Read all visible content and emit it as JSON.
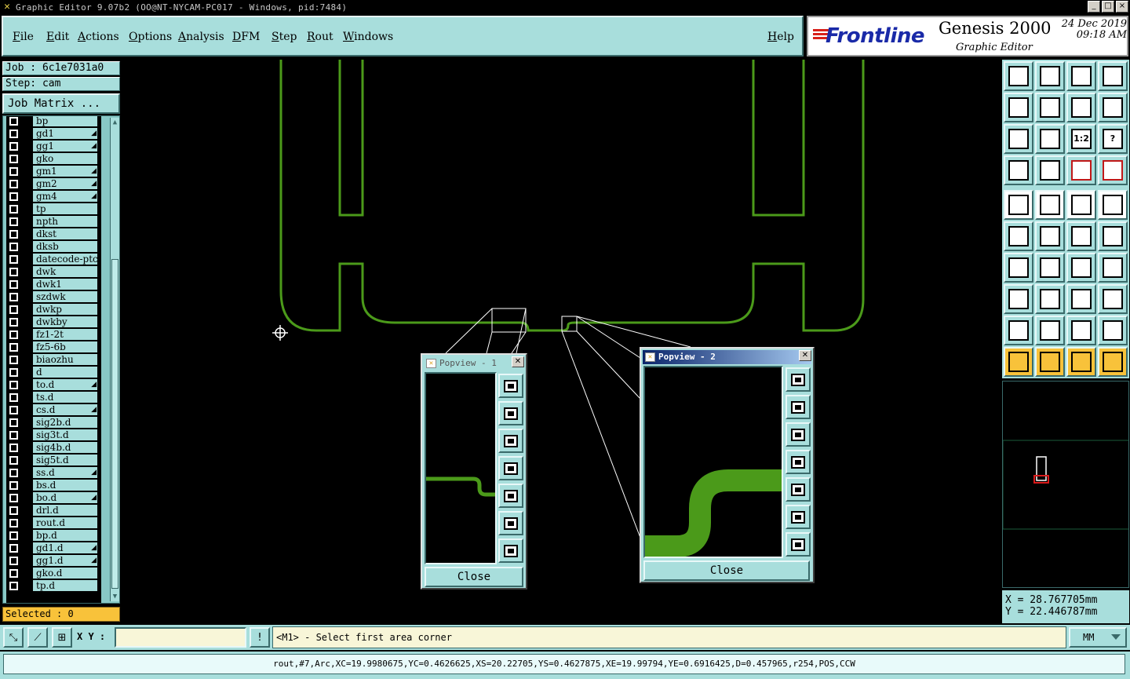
{
  "window": {
    "title": "Graphic Editor 9.07b2 (OO@NT-NYCAM-PC017 - Windows, pid:7484)",
    "controls": [
      "_",
      "□",
      "×"
    ]
  },
  "menu": [
    "File",
    "Edit",
    "Actions",
    "Options",
    "Analysis",
    "DFM",
    "Step",
    "Rout",
    "Windows"
  ],
  "help": "Help",
  "brand": {
    "logo": "Frontline",
    "product": "Genesis 2000",
    "subtitle": "Graphic Editor",
    "date": "24 Dec 2019",
    "time": "09:18 AM"
  },
  "job": {
    "job_label": "Job : 6c1e7031a0",
    "step_label": "Step: cam",
    "matrix_button": "Job Matrix ..."
  },
  "layers": [
    {
      "name": "bp",
      "mark": ""
    },
    {
      "name": "gd1",
      "mark": "◢"
    },
    {
      "name": "gg1",
      "mark": "◢"
    },
    {
      "name": "gko",
      "mark": ""
    },
    {
      "name": "gm1",
      "mark": "◢"
    },
    {
      "name": "gm2",
      "mark": "◢"
    },
    {
      "name": "gm4",
      "mark": "◢"
    },
    {
      "name": "tp",
      "mark": ""
    },
    {
      "name": "npth",
      "mark": ""
    },
    {
      "name": "dkst",
      "mark": ""
    },
    {
      "name": "dksb",
      "mark": ""
    },
    {
      "name": "datecode-ptc",
      "mark": ""
    },
    {
      "name": "dwk",
      "mark": ""
    },
    {
      "name": "dwk1",
      "mark": ""
    },
    {
      "name": "szdwk",
      "mark": ""
    },
    {
      "name": "dwkp",
      "mark": ""
    },
    {
      "name": "dwkby",
      "mark": ""
    },
    {
      "name": "fz1-2t",
      "mark": ""
    },
    {
      "name": "fz5-6b",
      "mark": ""
    },
    {
      "name": "biaozhu",
      "mark": ""
    },
    {
      "name": "d",
      "mark": ""
    },
    {
      "name": "to.d",
      "mark": "◢"
    },
    {
      "name": "ts.d",
      "mark": ""
    },
    {
      "name": "cs.d",
      "mark": "◢"
    },
    {
      "name": "sig2b.d",
      "mark": ""
    },
    {
      "name": "sig3t.d",
      "mark": ""
    },
    {
      "name": "sig4b.d",
      "mark": ""
    },
    {
      "name": "sig5t.d",
      "mark": ""
    },
    {
      "name": "ss.d",
      "mark": "◢"
    },
    {
      "name": "bs.d",
      "mark": ""
    },
    {
      "name": "bo.d",
      "mark": "◢"
    },
    {
      "name": "drl.d",
      "mark": ""
    },
    {
      "name": "rout.d",
      "mark": ""
    },
    {
      "name": "bp.d",
      "mark": ""
    },
    {
      "name": "gd1.d",
      "mark": "◢"
    },
    {
      "name": "gg1.d",
      "mark": "◢"
    },
    {
      "name": "gko.d",
      "mark": ""
    },
    {
      "name": "tp.d",
      "mark": ""
    }
  ],
  "selected": "Selected : 0",
  "popview1": {
    "title": "Popview - 1",
    "close": "Close"
  },
  "popview2": {
    "title": "Popview - 2",
    "close": "Close"
  },
  "toolbar_icons": [
    "zoom-home-icon",
    "zoom-fit-icon",
    "home-icon",
    "window-split-icon",
    "pan-left-icon",
    "pan-right-icon",
    "undo-view-icon",
    "redraw-icon",
    "zoom-out-icon",
    "zoom-in-icon",
    "scale-1-2-icon",
    "help-icon",
    "measure-icon",
    "snap-icon",
    "layer-toggle-icon",
    "layer-toggle-2-icon",
    "select-icon",
    "area-icon",
    "ruler-icon",
    "pad-icon",
    "net-icon",
    "cross-icon",
    "line-icon",
    "arrow-icon",
    "angle-icon",
    "draw-line-icon",
    "arc-icon",
    "text-icon",
    "point-icon",
    "minus-icon",
    "ruler-2-icon",
    "shape-icon",
    "triangle-icon",
    "triangle-2-icon",
    "triangle-3-icon",
    "triangle-4-icon",
    "pointer-icon",
    "pointer-2-icon",
    "pointer-3-icon",
    "path-icon"
  ],
  "toolbar_labels": {
    "scale": "1:2",
    "help": "?"
  },
  "coords": {
    "x": "X = 28.767705mm",
    "y": "Y = 22.446787mm"
  },
  "cmd": {
    "xy_label": "X Y :",
    "xy_value": "",
    "prompt": "<M1> - Select first area corner",
    "units": "MM"
  },
  "status": "rout,#7,Arc,XC=19.9980675,YC=0.4626625,XS=20.22705,YS=0.4627875,XE=19.99794,YE=0.6916425,D=0.457965,r254,POS,CCW"
}
